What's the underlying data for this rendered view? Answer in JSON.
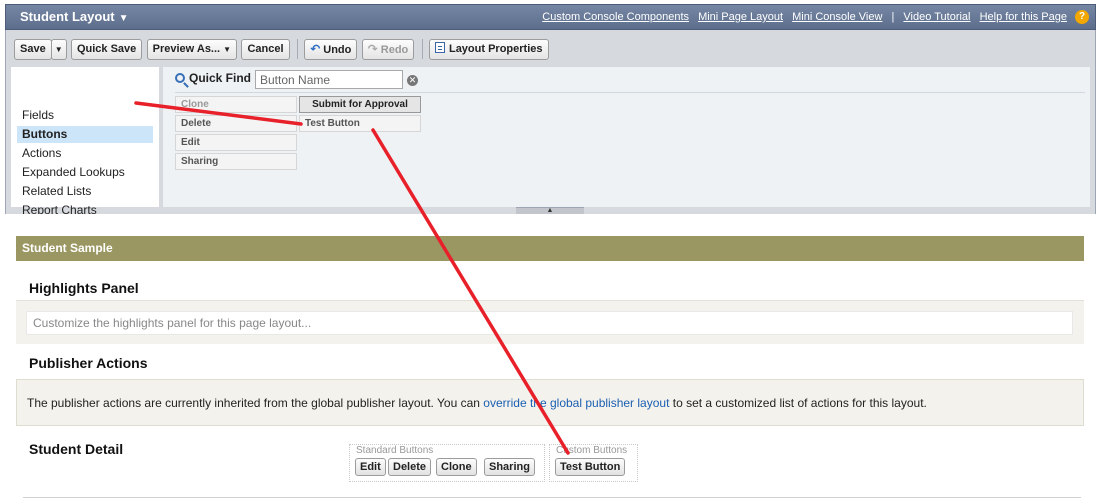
{
  "header": {
    "title": "Student Layout",
    "links": [
      "Custom Console Components",
      "Mini Page Layout",
      "Mini Console View",
      "Video Tutorial",
      "Help for this Page"
    ],
    "separator": "|",
    "help_glyph": "?"
  },
  "toolbar": {
    "save": "Save",
    "quick_save": "Quick Save",
    "preview_as": "Preview As...",
    "cancel": "Cancel",
    "undo": "Undo",
    "redo": "Redo",
    "layout_properties": "Layout Properties"
  },
  "palette": {
    "categories": [
      "Fields",
      "Buttons",
      "Actions",
      "Expanded Lookups",
      "Related Lists",
      "Report Charts"
    ],
    "active_category": "Buttons",
    "quick_find_label": "Quick Find",
    "quick_find_placeholder": "Button Name",
    "items": [
      "Clone",
      "Delete",
      "Edit",
      "Sharing",
      "Submit for Approval",
      "Test Button"
    ]
  },
  "canvas": {
    "sample_title": "Student Sample",
    "highlights": {
      "title": "Highlights Panel",
      "placeholder": "Customize the highlights panel for this page layout..."
    },
    "publisher": {
      "title": "Publisher Actions",
      "text_before": "The publisher actions are currently inherited from the global publisher layout. You can ",
      "link": "override the global publisher layout",
      "text_after": " to set a customized list of actions for this layout."
    },
    "detail": {
      "title": "Student Detail",
      "standard_label": "Standard Buttons",
      "standard_buttons": [
        "Edit",
        "Delete",
        "Clone",
        "Sharing"
      ],
      "custom_label": "Custom Buttons",
      "custom_buttons": [
        "Test Button"
      ]
    }
  },
  "colors": {
    "header_bg": "#667796",
    "section_bar": "#9b9762",
    "active_category": "#cce5f8",
    "annotation": "#e8202a",
    "link": "#1b5fb3"
  }
}
